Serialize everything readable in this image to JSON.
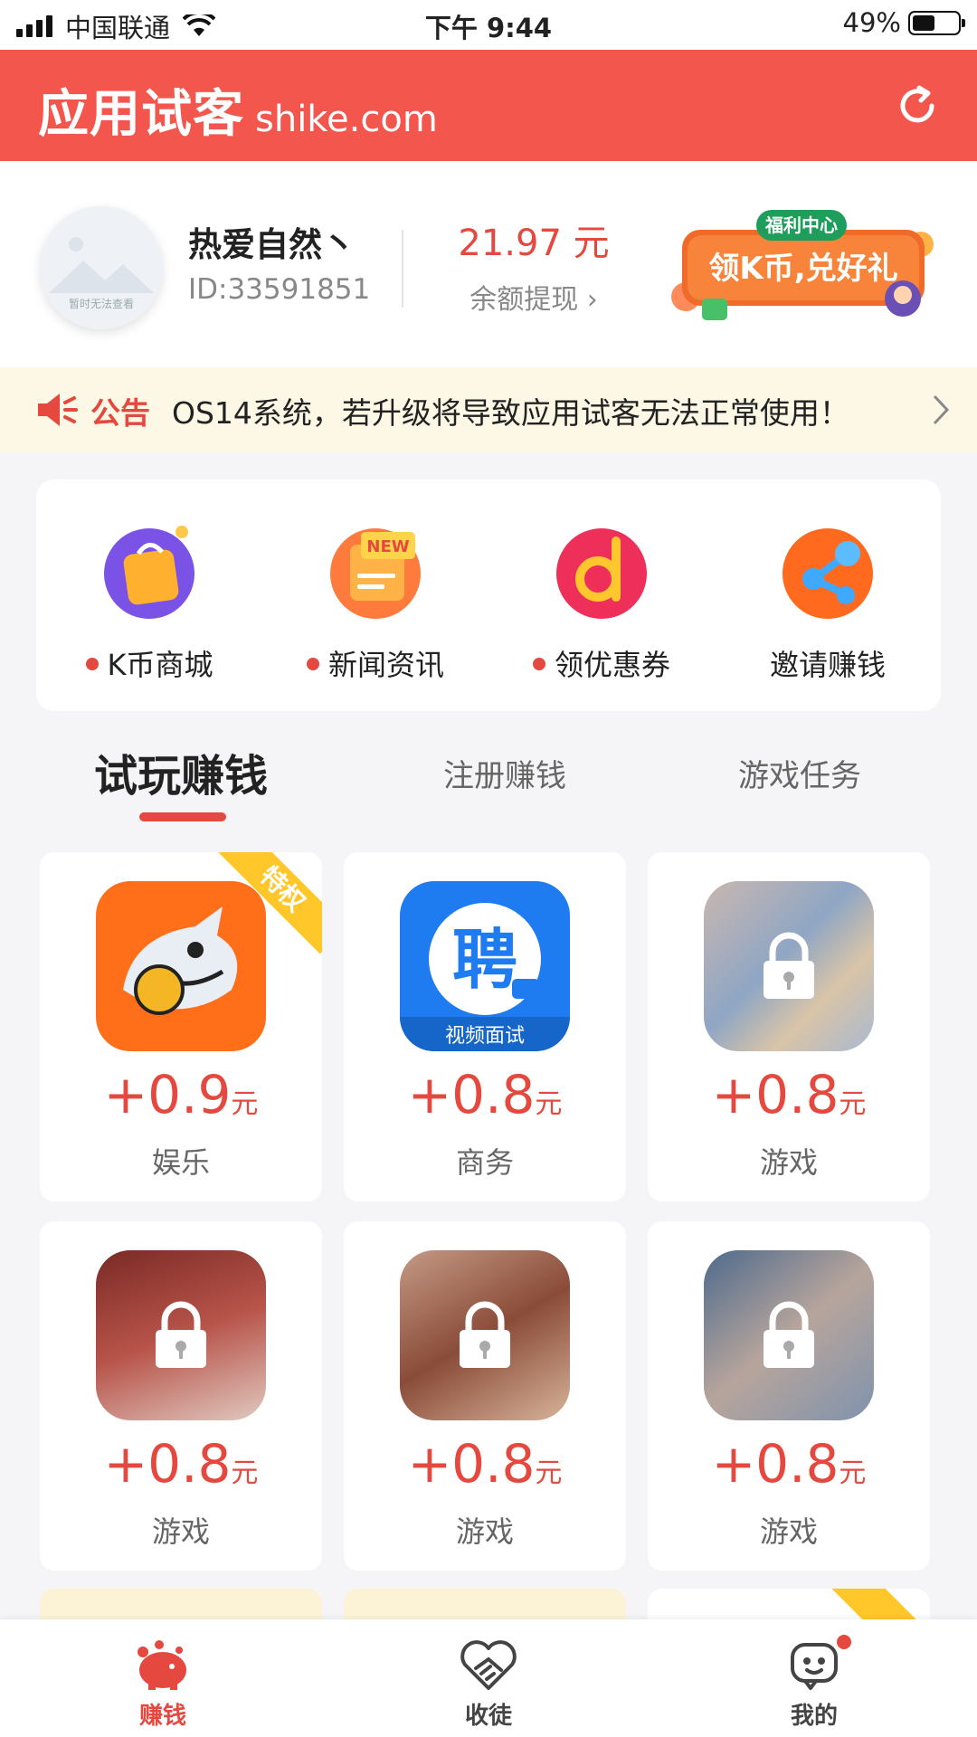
{
  "status_bar": {
    "carrier": "中国联通",
    "time": "下午 9:44",
    "battery_percent": "49%",
    "battery_level": 0.49
  },
  "header": {
    "brand_cn": "应用试客",
    "brand_domain": "shike.com",
    "refresh_icon": "refresh-icon"
  },
  "profile": {
    "username": "热爱自然丶",
    "user_id": "ID:33591851",
    "avatar_caption": "暂时无法查看",
    "balance": "21.97 元",
    "withdraw_label": "余额提现 ›"
  },
  "welfare_banner": {
    "badge": "福利中心",
    "text": "领K币,兑好礼"
  },
  "notice": {
    "label": "公告",
    "text": "OS14系统，若升级将导致应用试客无法正常使用！"
  },
  "quick_menu": [
    {
      "label": "K币商城",
      "icon": "shopping-bag-icon",
      "dot": true
    },
    {
      "label": "新闻资讯",
      "icon": "news-icon",
      "dot": true
    },
    {
      "label": "领优惠券",
      "icon": "coupon-icon",
      "dot": true
    },
    {
      "label": "邀请赚钱",
      "icon": "share-icon",
      "dot": false
    }
  ],
  "tabs": [
    {
      "label": "试玩赚钱",
      "active": true
    },
    {
      "label": "注册赚钱",
      "active": false
    },
    {
      "label": "游戏任务",
      "active": false
    }
  ],
  "tasks": [
    {
      "reward": "+0.9",
      "unit": "元",
      "category": "娱乐",
      "ribbon": "特权",
      "locked": false,
      "icon": "shark-app-icon"
    },
    {
      "reward": "+0.8",
      "unit": "元",
      "category": "商务",
      "ribbon": "",
      "locked": false,
      "icon": "job-app-icon",
      "icon_caption": "视频面试",
      "icon_glyph": "聘"
    },
    {
      "reward": "+0.8",
      "unit": "元",
      "category": "游戏",
      "ribbon": "",
      "locked": true,
      "icon": "lock-icon"
    },
    {
      "reward": "+0.8",
      "unit": "元",
      "category": "游戏",
      "ribbon": "",
      "locked": true,
      "icon": "lock-icon"
    },
    {
      "reward": "+0.8",
      "unit": "元",
      "category": "游戏",
      "ribbon": "",
      "locked": true,
      "icon": "lock-icon"
    },
    {
      "reward": "+0.8",
      "unit": "元",
      "category": "游戏",
      "ribbon": "",
      "locked": true,
      "icon": "lock-icon"
    }
  ],
  "bottom_nav": [
    {
      "label": "赚钱",
      "icon": "piggy-bank-icon",
      "active": true
    },
    {
      "label": "收徒",
      "icon": "handshake-icon",
      "active": false
    },
    {
      "label": "我的",
      "icon": "profile-icon",
      "active": false,
      "badge": true
    }
  ],
  "colors": {
    "brand_red": "#f2564c",
    "price_red": "#e4483e",
    "notice_bg": "#fcf8e5",
    "ribbon_yellow": "#ffc72a"
  }
}
